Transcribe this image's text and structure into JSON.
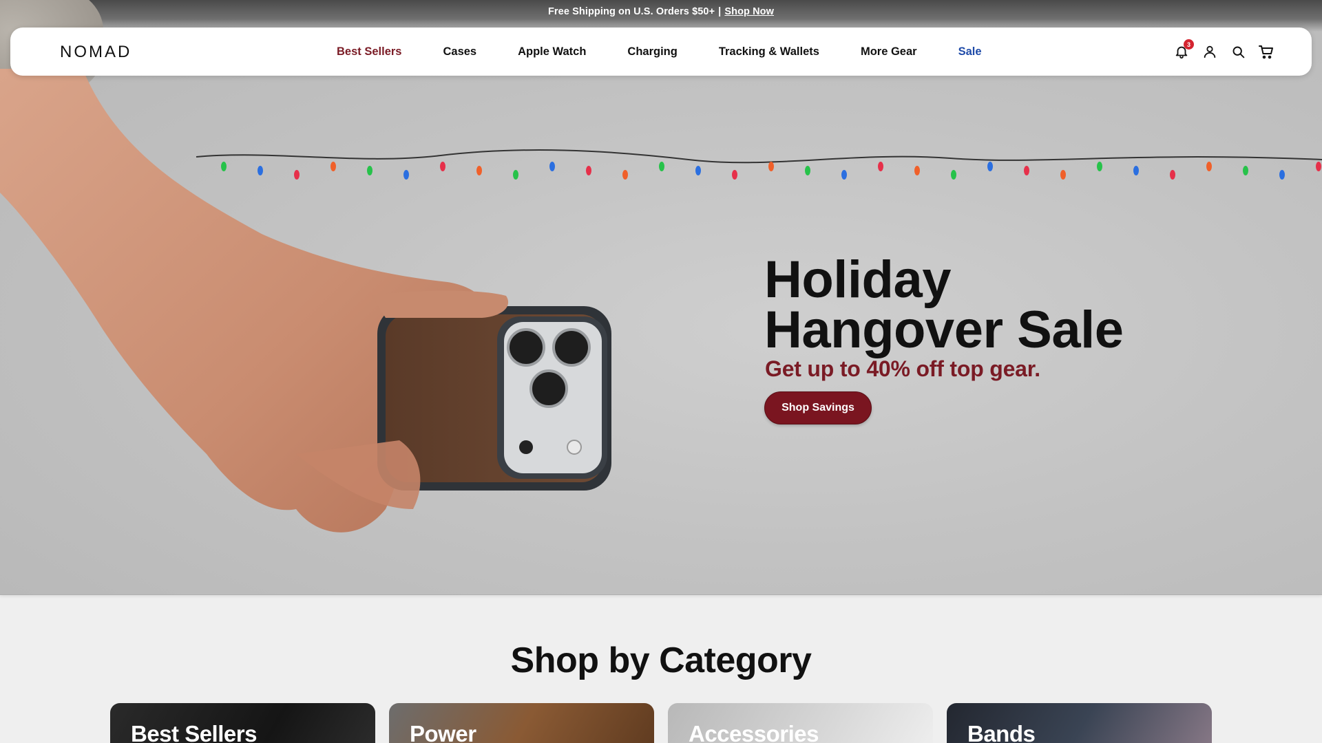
{
  "announcement": {
    "text": "Free Shipping on U.S. Orders $50+",
    "separator": "|",
    "link": "Shop Now"
  },
  "header": {
    "logo": "NOMAD",
    "nav": [
      {
        "label": "Best Sellers"
      },
      {
        "label": "Cases"
      },
      {
        "label": "Apple Watch"
      },
      {
        "label": "Charging"
      },
      {
        "label": "Tracking & Wallets"
      },
      {
        "label": "More Gear"
      },
      {
        "label": "Sale"
      }
    ],
    "icons": [
      "bell-icon",
      "account-icon",
      "search-icon",
      "cart-icon"
    ],
    "notification_count": "3"
  },
  "hero": {
    "title_line1": "Holiday",
    "title_line2": "Hangover Sale",
    "subtitle": "Get up to 40% off top gear.",
    "cta": "Shop Savings"
  },
  "categories": {
    "title": "Shop by Category",
    "items": [
      {
        "label": "Best Sellers"
      },
      {
        "label": "Power"
      },
      {
        "label": "Accessories"
      },
      {
        "label": "Bands"
      }
    ]
  },
  "colors": {
    "accent_maroon": "#7a1b25",
    "sale_blue": "#1e4aa8",
    "badge_red": "#d4242f"
  }
}
